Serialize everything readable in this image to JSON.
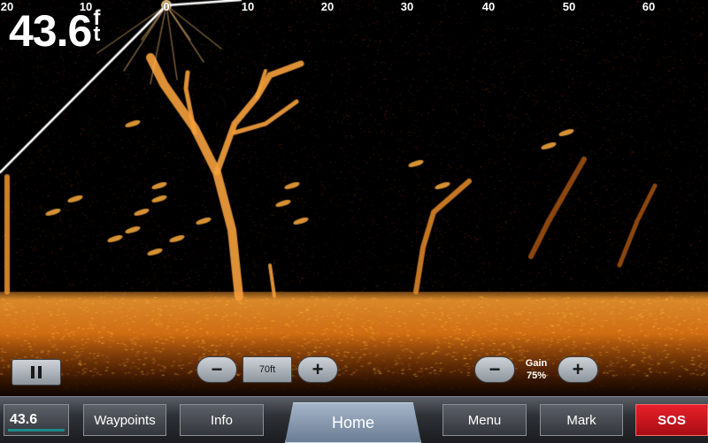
{
  "sonar": {
    "depth_value": "43.6",
    "depth_unit": "ft",
    "scale_labels": [
      "20",
      "10",
      "0",
      "10",
      "20",
      "30",
      "40",
      "50",
      "60"
    ],
    "colors": {
      "background": "#000000",
      "echo": "#f0a030",
      "beam": "#ffffff"
    }
  },
  "controls": {
    "pause_icon": "pause-icon",
    "range_minus": "−",
    "range_value": "70ft",
    "range_plus": "+",
    "gain_minus": "−",
    "gain_label": "Gain",
    "gain_value": "75%",
    "gain_plus": "+"
  },
  "bottom_bar": {
    "mini_depth": "43.6",
    "waypoints": "Waypoints",
    "info": "Info",
    "home": "Home",
    "menu": "Menu",
    "mark": "Mark",
    "sos": "SOS",
    "sos_color": "#e8202a",
    "home_color": "#8a9bb2"
  }
}
